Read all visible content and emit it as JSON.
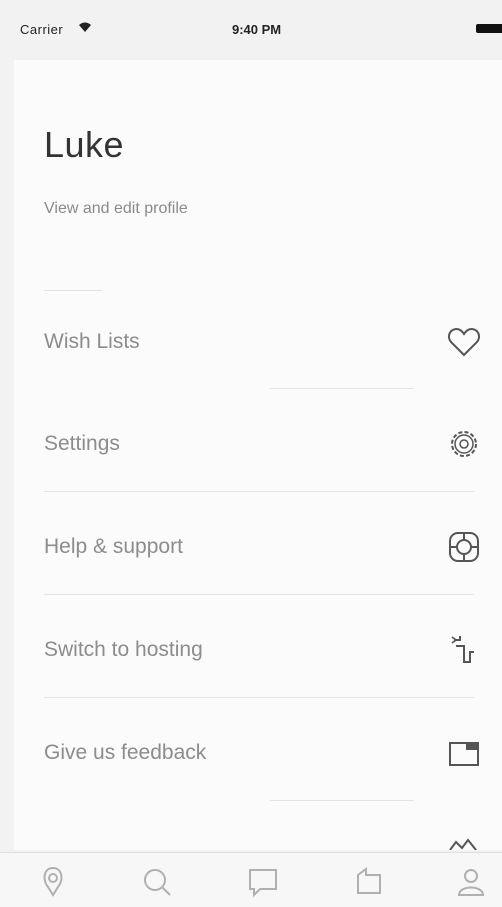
{
  "status_bar": {
    "carrier": "Carrier",
    "time": "9:40 PM"
  },
  "profile": {
    "name": "Luke",
    "view_link": "View and edit profile"
  },
  "menu": {
    "items": [
      {
        "label": "Wish Lists",
        "icon": "heart-icon"
      },
      {
        "label": "Settings",
        "icon": "gear-icon"
      },
      {
        "label": "Help & support",
        "icon": "lifebuoy-icon"
      },
      {
        "label": "Switch to hosting",
        "icon": "switch-hosting-icon"
      },
      {
        "label": "Give us feedback",
        "icon": "feedback-icon"
      }
    ]
  },
  "tabs": [
    {
      "icon": "home-icon"
    },
    {
      "icon": "search-icon"
    },
    {
      "icon": "messages-icon"
    },
    {
      "icon": "trips-icon"
    },
    {
      "icon": "profile-icon"
    }
  ],
  "colors": {
    "background": "#f2f2f2",
    "panel": "#fbfbfb",
    "text_primary": "#333333",
    "text_secondary": "#8c8c8c"
  }
}
